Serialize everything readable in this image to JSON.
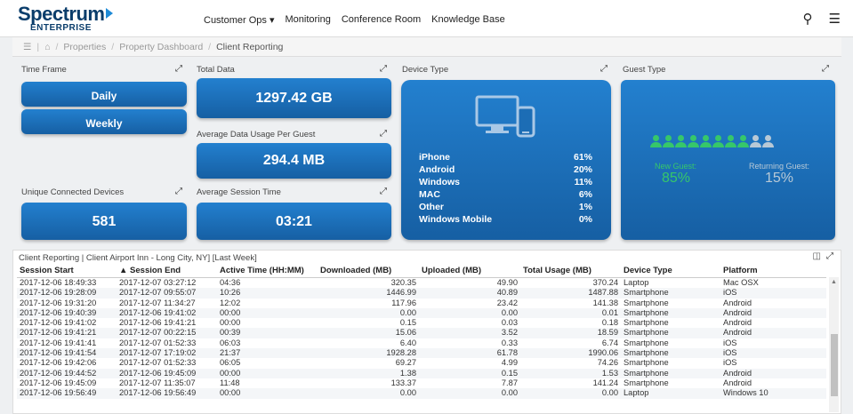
{
  "brand": {
    "name": "Spectrum",
    "sub": "ENTERPRISE"
  },
  "nav": [
    "Customer Ops ▾",
    "Monitoring",
    "Conference Room",
    "Knowledge Base"
  ],
  "breadcrumb": [
    "Properties",
    "Property Dashboard",
    "Client Reporting"
  ],
  "time_frame": {
    "title": "Time Frame",
    "daily": "Daily",
    "weekly": "Weekly"
  },
  "total_data": {
    "title": "Total Data",
    "value": "1297.42 GB"
  },
  "avg_usage": {
    "title": "Average Data Usage Per Guest",
    "value": "294.4 MB"
  },
  "unique_devices": {
    "title": "Unique Connected Devices",
    "value": "581"
  },
  "avg_session": {
    "title": "Average Session Time",
    "value": "03:21"
  },
  "device_type": {
    "title": "Device Type",
    "rows": [
      {
        "name": "iPhone",
        "pct": "61%"
      },
      {
        "name": "Android",
        "pct": "20%"
      },
      {
        "name": "Windows",
        "pct": "11%"
      },
      {
        "name": "MAC",
        "pct": "6%"
      },
      {
        "name": "Other",
        "pct": "1%"
      },
      {
        "name": "Windows Mobile",
        "pct": "0%"
      }
    ]
  },
  "guest_type": {
    "title": "Guest Type",
    "new_label": "New Guest:",
    "new_value": "85%",
    "returning_label": "Returning Guest:",
    "returning_value": "15%",
    "new_color": "#36c76a",
    "returning_color": "#b8c9d6",
    "new_count": 8,
    "total_count": 10
  },
  "table": {
    "title": "Client Reporting | Client Airport Inn - Long City, NY] [Last Week]",
    "columns": [
      "Session Start",
      "▲ Session End",
      "Active Time (HH:MM)",
      "Downloaded (MB)",
      "Uploaded (MB)",
      "Total Usage (MB)",
      "Device Type",
      "Platform"
    ],
    "rows": [
      [
        "2017-12-06 18:49:33",
        "2017-12-07 03:27:12",
        "04:36",
        "320.35",
        "49.90",
        "370.24",
        "Laptop",
        "Mac OSX"
      ],
      [
        "2017-12-06 19:28:09",
        "2017-12-07 09:55:07",
        "10:26",
        "1446.99",
        "40.89",
        "1487.88",
        "Smartphone",
        "iOS"
      ],
      [
        "2017-12-06 19:31:20",
        "2017-12-07 11:34:27",
        "12:02",
        "117.96",
        "23.42",
        "141.38",
        "Smartphone",
        "Android"
      ],
      [
        "2017-12-06 19:40:39",
        "2017-12-06 19:41:02",
        "00:00",
        "0.00",
        "0.00",
        "0.01",
        "Smartphone",
        "Android"
      ],
      [
        "2017-12-06 19:41:02",
        "2017-12-06 19:41:21",
        "00:00",
        "0.15",
        "0.03",
        "0.18",
        "Smartphone",
        "Android"
      ],
      [
        "2017-12-06 19:41:21",
        "2017-12-07 00:22:15",
        "00:39",
        "15.06",
        "3.52",
        "18.59",
        "Smartphone",
        "Android"
      ],
      [
        "2017-12-06 19:41:41",
        "2017-12-07 01:52:33",
        "06:03",
        "6.40",
        "0.33",
        "6.74",
        "Smartphone",
        "iOS"
      ],
      [
        "2017-12-06 19:41:54",
        "2017-12-07 17:19:02",
        "21:37",
        "1928.28",
        "61.78",
        "1990.06",
        "Smartphone",
        "iOS"
      ],
      [
        "2017-12-06 19:42:06",
        "2017-12-07 01:52:33",
        "06:05",
        "69.27",
        "4.99",
        "74.26",
        "Smartphone",
        "iOS"
      ],
      [
        "2017-12-06 19:44:52",
        "2017-12-06 19:45:09",
        "00:00",
        "1.38",
        "0.15",
        "1.53",
        "Smartphone",
        "Android"
      ],
      [
        "2017-12-06 19:45:09",
        "2017-12-07 11:35:07",
        "11:48",
        "133.37",
        "7.87",
        "141.24",
        "Smartphone",
        "Android"
      ],
      [
        "2017-12-06 19:56:49",
        "2017-12-06 19:56:49",
        "00:00",
        "0.00",
        "0.00",
        "0.00",
        "Laptop",
        "Windows 10"
      ]
    ]
  }
}
